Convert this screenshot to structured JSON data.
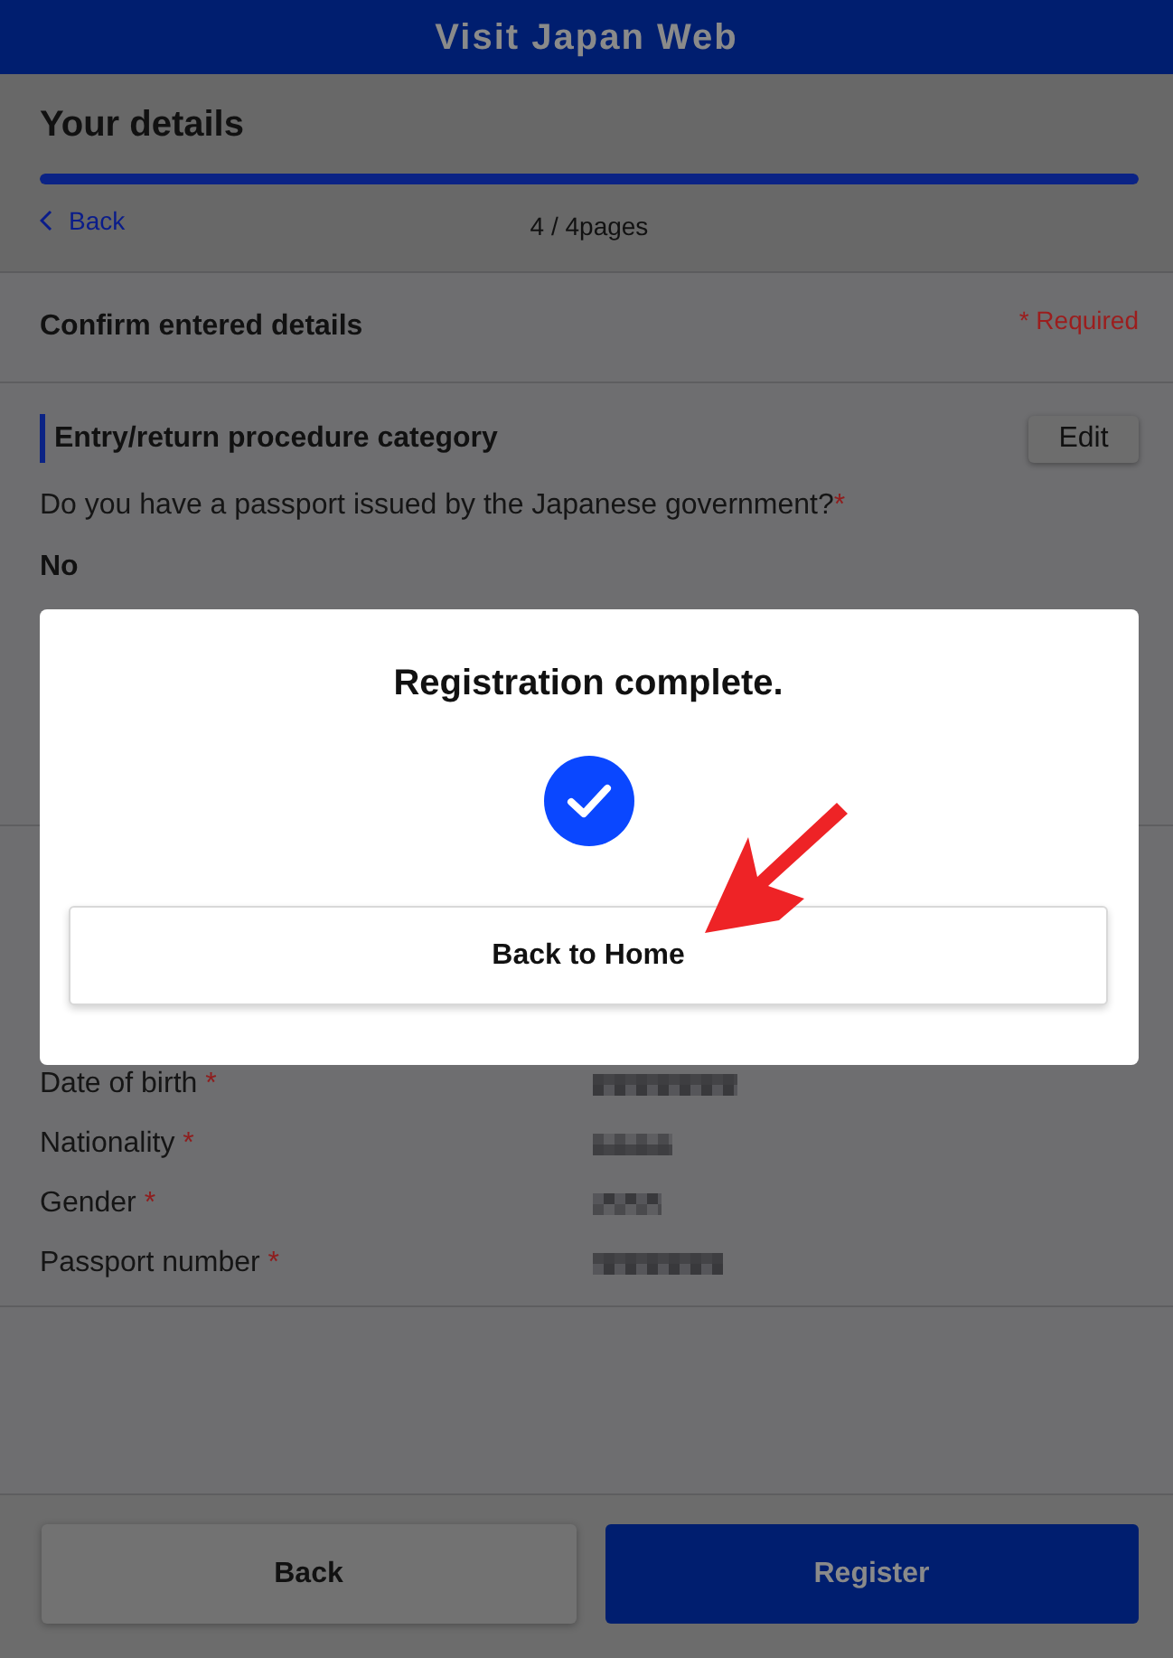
{
  "header": {
    "title": "Visit Japan Web"
  },
  "page": {
    "title": "Your details",
    "progress": {
      "level": 1
    },
    "back_link": "Back",
    "page_counter": "4 / 4pages"
  },
  "confirm": {
    "title": "Confirm entered details",
    "required_note": "* Required"
  },
  "sections": [
    {
      "title": "Entry/return procedure category",
      "edit_button": "Edit",
      "fields": [
        {
          "kind": "question",
          "label": "Do you have a passport issued by the Japanese government?",
          "required_mark": "*",
          "value": "No"
        }
      ]
    },
    {
      "fields": [
        {
          "kind": "row",
          "label": "Date of birth",
          "required_mark": "*"
        },
        {
          "kind": "row",
          "label": "Nationality",
          "required_mark": "*"
        },
        {
          "kind": "row",
          "label": "Gender",
          "required_mark": "*"
        },
        {
          "kind": "row",
          "label": "Passport number",
          "required_mark": "*"
        }
      ]
    }
  ],
  "dialog": {
    "title": "Registration complete.",
    "button": "Back to Home"
  },
  "footer_buttons": [
    {
      "label": "Back",
      "kind": "secondary"
    },
    {
      "label": "Register",
      "kind": "primary"
    }
  ]
}
